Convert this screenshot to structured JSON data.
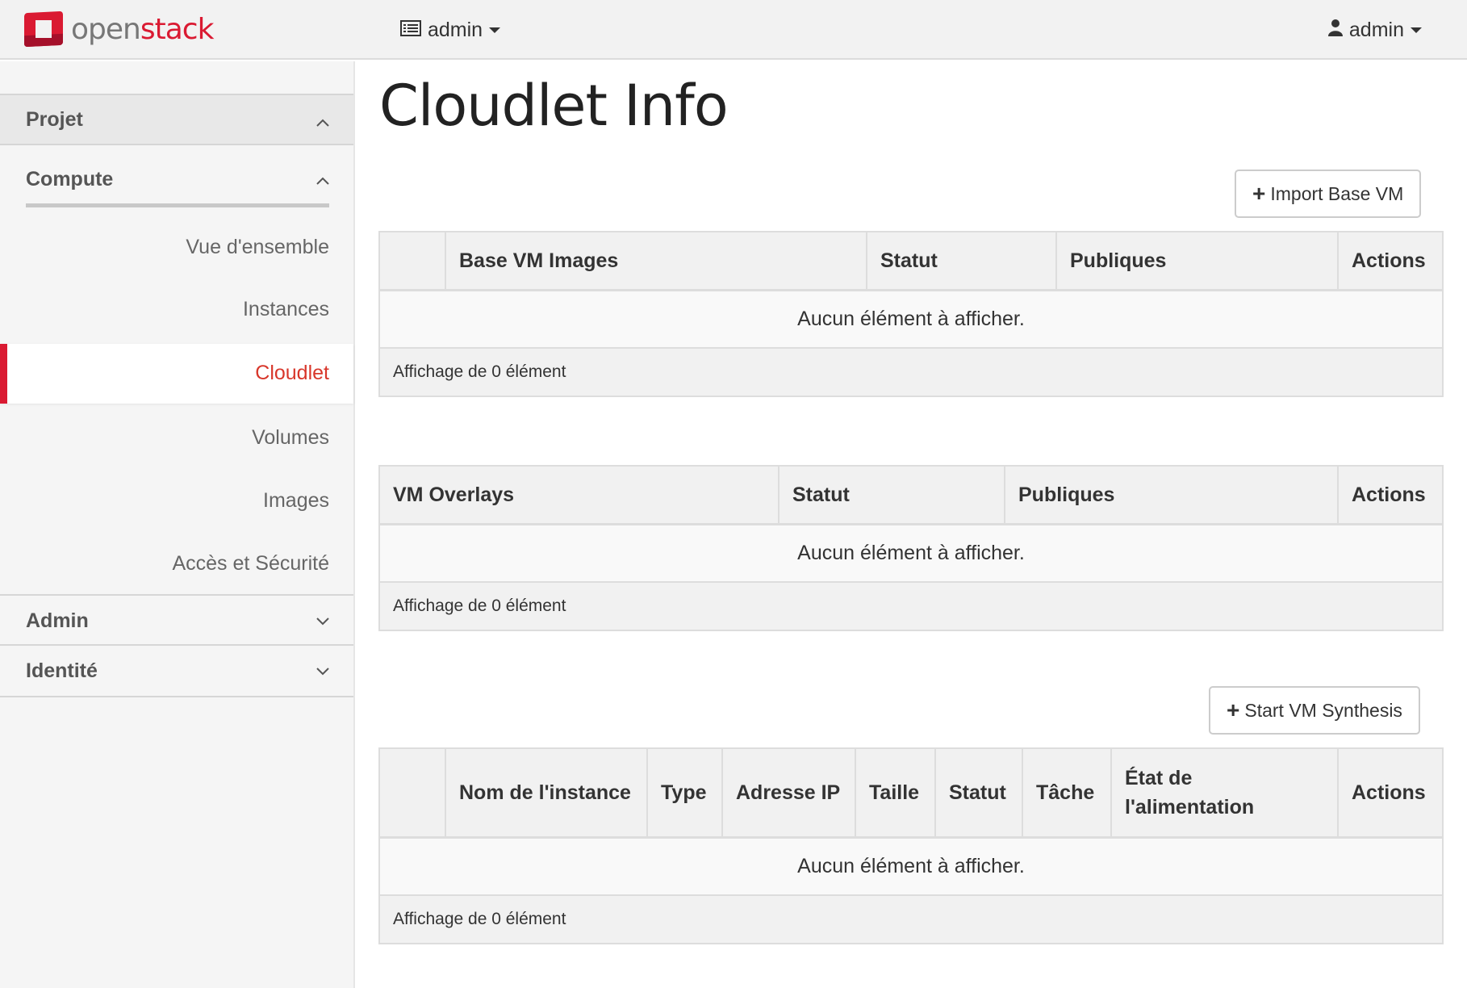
{
  "topbar": {
    "logo_text_open": "open",
    "logo_text_stack": "stack",
    "project_selector": "admin",
    "user_menu": "admin"
  },
  "sidebar": {
    "project": "Projet",
    "compute": "Compute",
    "items": [
      {
        "label": "Vue d'ensemble"
      },
      {
        "label": "Instances"
      },
      {
        "label": "Cloudlet"
      },
      {
        "label": "Volumes"
      },
      {
        "label": "Images"
      },
      {
        "label": "Accès et Sécurité"
      }
    ],
    "admin": "Admin",
    "identity": "Identité"
  },
  "main": {
    "title": "Cloudlet Info",
    "import_button": "Import Base VM",
    "synthesis_button": "Start VM Synthesis",
    "base_table": {
      "headers": [
        "Base VM Images",
        "Statut",
        "Publiques",
        "Actions"
      ],
      "empty": "Aucun élément à afficher.",
      "footer": "Affichage de 0 élément"
    },
    "overlay_table": {
      "headers": [
        "VM Overlays",
        "Statut",
        "Publiques",
        "Actions"
      ],
      "empty": "Aucun élément à afficher.",
      "footer": "Affichage de 0 élément"
    },
    "instance_table": {
      "headers": [
        "Nom de l'instance",
        "Type",
        "Adresse IP",
        "Taille",
        "Statut",
        "Tâche",
        "État de l'alimentation",
        "Actions"
      ],
      "empty": "Aucun élément à afficher.",
      "footer": "Affichage de 0 élément"
    }
  },
  "colors": {
    "brand": "#da1a32",
    "active_link": "#d8372b"
  }
}
